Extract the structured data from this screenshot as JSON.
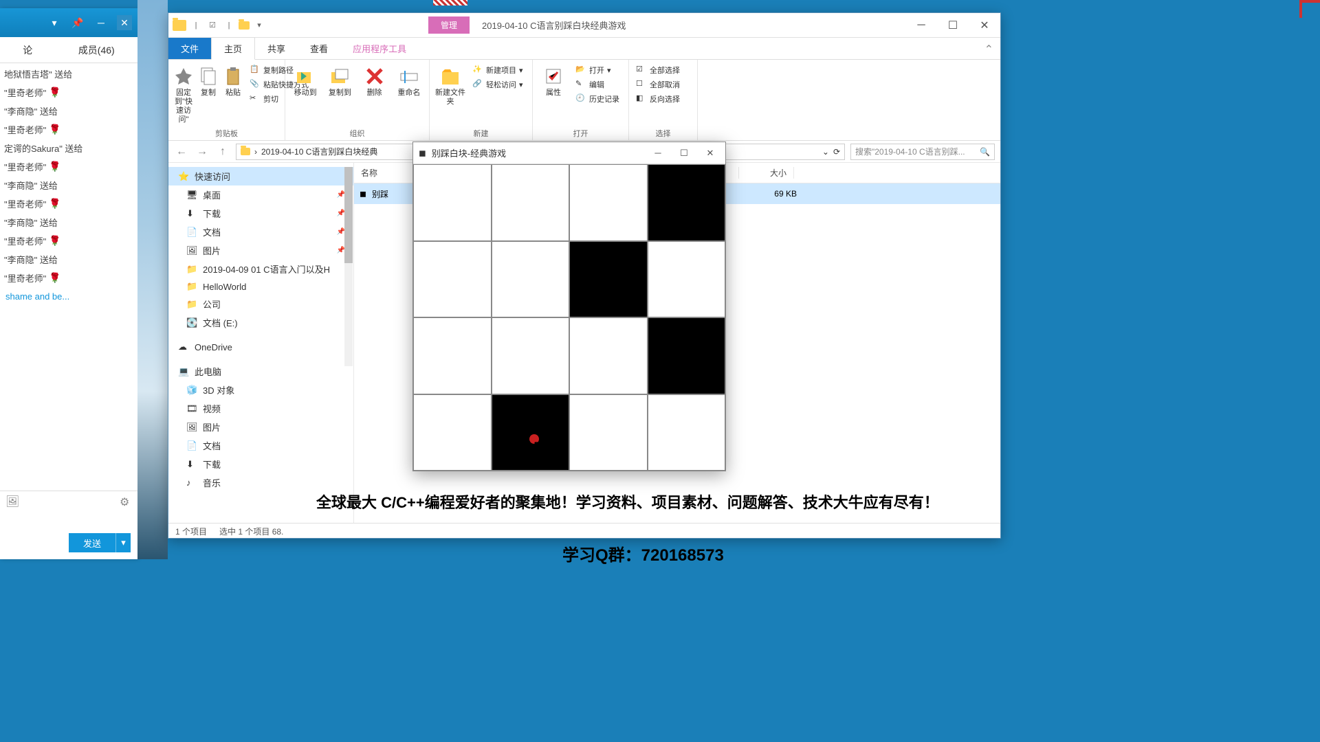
{
  "im": {
    "tabs": {
      "t1": "论",
      "t2": "成员(46)"
    },
    "lines": [
      "地狱悟吉塔\" 送给",
      "\"里奇老师\"",
      "\"李商隐\" 送给",
      "\"里奇老师\"",
      "定谔的Sakura\" 送给",
      "\"里奇老师\"",
      "\"李商隐\" 送给",
      "\"里奇老师\"",
      "\"李商隐\" 送给",
      "\"里奇老师\"",
      "\"李商隐\" 送给",
      "\"里奇老师\""
    ],
    "link": "shame and be...",
    "send": "发送"
  },
  "explorer": {
    "context_tab": "管理",
    "title": "2019-04-10 C语言别踩白块经典游戏",
    "tabs": {
      "file": "文件",
      "home": "主页",
      "share": "共享",
      "view": "查看",
      "app": "应用程序工具"
    },
    "ribbon": {
      "pin": "固定到\"快速访问\"",
      "copy": "复制",
      "paste": "粘贴",
      "copy_path": "复制路径",
      "paste_shortcut": "粘贴快捷方式",
      "cut": "剪切",
      "clipboard": "剪贴板",
      "move_to": "移动到",
      "copy_to": "复制到",
      "delete": "删除",
      "rename": "重命名",
      "organize": "组织",
      "new_folder": "新建文件夹",
      "new_item": "新建项目",
      "easy_access": "轻松访问",
      "new": "新建",
      "properties": "属性",
      "open": "打开",
      "edit": "编辑",
      "history": "历史记录",
      "open_g": "打开",
      "select_all": "全部选择",
      "select_none": "全部取消",
      "invert": "反向选择",
      "select_g": "选择"
    },
    "address": "2019-04-10 C语言别踩白块经典",
    "search_ph": "搜索\"2019-04-10 C语言别踩...",
    "nav": {
      "quick": "快速访问",
      "desktop": "桌面",
      "downloads": "下载",
      "documents": "文档",
      "pictures": "图片",
      "f1": "2019-04-09  01 C语言入门以及H",
      "f2": "HelloWorld",
      "f3": "公司",
      "f4": "文档 (E:)",
      "onedrive": "OneDrive",
      "thispc": "此电脑",
      "obj3d": "3D 对象",
      "videos": "视频",
      "pictures2": "图片",
      "documents2": "文档",
      "downloads2": "下载",
      "music": "音乐"
    },
    "cols": {
      "name": "名称",
      "size": "大小"
    },
    "file": {
      "name": "别踩",
      "size": "69 KB"
    },
    "status": {
      "count": "1 个项目",
      "sel": "选中 1 个项目  68."
    }
  },
  "game": {
    "title": "别踩白块-经典游戏"
  },
  "promo": {
    "line1": "全球最大 C/C++编程爱好者的聚集地！学习资料、项目素材、问题解答、技术大牛应有尽有！",
    "line2": "学习Q群：720168573"
  }
}
